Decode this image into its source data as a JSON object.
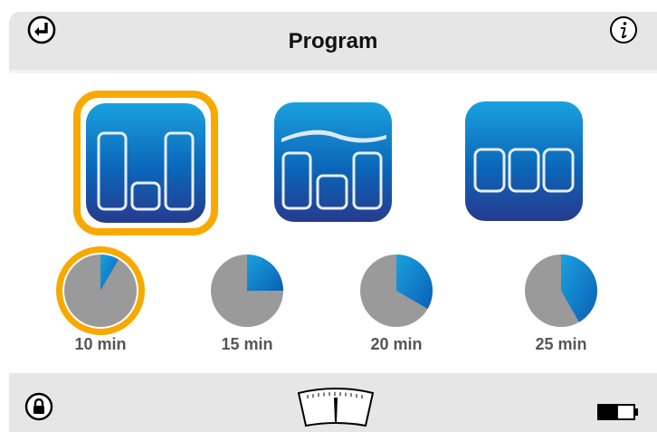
{
  "header": {
    "title": "Program",
    "back_icon": "return-arrow-icon",
    "info_icon": "info-icon"
  },
  "programs": [
    {
      "name": "program-1",
      "icon": "bars-low-middle-icon",
      "selected": true
    },
    {
      "name": "program-2",
      "icon": "bars-wave-icon",
      "selected": false
    },
    {
      "name": "program-3",
      "icon": "bars-flat-icon",
      "selected": false
    }
  ],
  "durations": [
    {
      "label": "10 min",
      "fraction": 0.0833,
      "selected": true
    },
    {
      "label": "15 min",
      "fraction": 0.25,
      "selected": false
    },
    {
      "label": "20 min",
      "fraction": 0.3333,
      "selected": false
    },
    {
      "label": "25 min",
      "fraction": 0.4167,
      "selected": false
    }
  ],
  "footer": {
    "lock_icon": "lock-icon",
    "gauge_icon": "gauge-icon",
    "battery_icon": "battery-icon",
    "battery_level": 0.55
  },
  "colors": {
    "accent": "#f7a900",
    "tile_top": "#1aa1de",
    "tile_bottom": "#263b8e",
    "pie_gray": "#9a9a9a",
    "pie_blue": "#1577c9"
  }
}
